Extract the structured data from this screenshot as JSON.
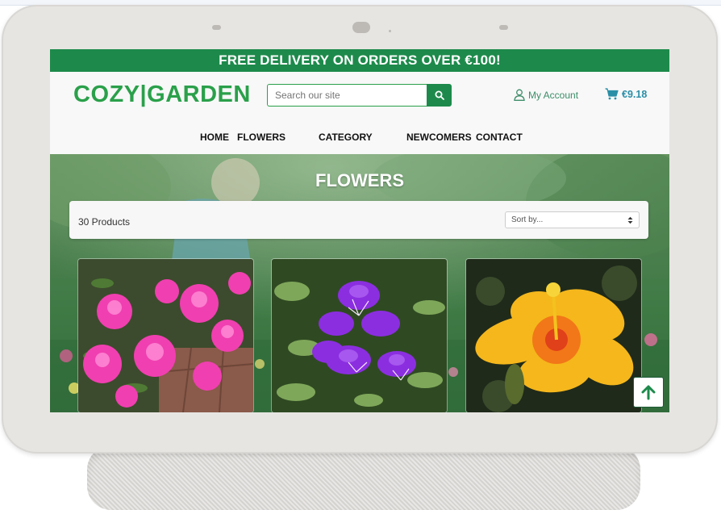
{
  "promo": {
    "text": "FREE DELIVERY ON ORDERS OVER €100!"
  },
  "header": {
    "logo": "COZY|GARDEN",
    "search": {
      "placeholder": "Search our site"
    },
    "account_label": "My Account",
    "cart_total": "€9.18"
  },
  "nav": {
    "items": [
      {
        "label": "HOME"
      },
      {
        "label": "FLOWERS"
      },
      {
        "label": "CATEGORY"
      },
      {
        "label": "NEWCOMERS"
      },
      {
        "label": "CONTACT"
      }
    ]
  },
  "hero": {
    "title": "FLOWERS"
  },
  "toolbar": {
    "product_count": "30 Products",
    "sort": {
      "selected": "Sort by..."
    }
  },
  "products": [
    {
      "image": "pink-azalea"
    },
    {
      "image": "purple-tibouchina"
    },
    {
      "image": "yellow-hibiscus"
    }
  ],
  "colors": {
    "brand_green": "#2aa04a",
    "promo_green": "#1d8a4b",
    "cart_teal": "#2a8fa7",
    "account_green": "#3d8d69"
  },
  "icons": [
    "search-icon",
    "user-icon",
    "cart-icon",
    "arrow-up-icon",
    "sort-caret-icon"
  ]
}
